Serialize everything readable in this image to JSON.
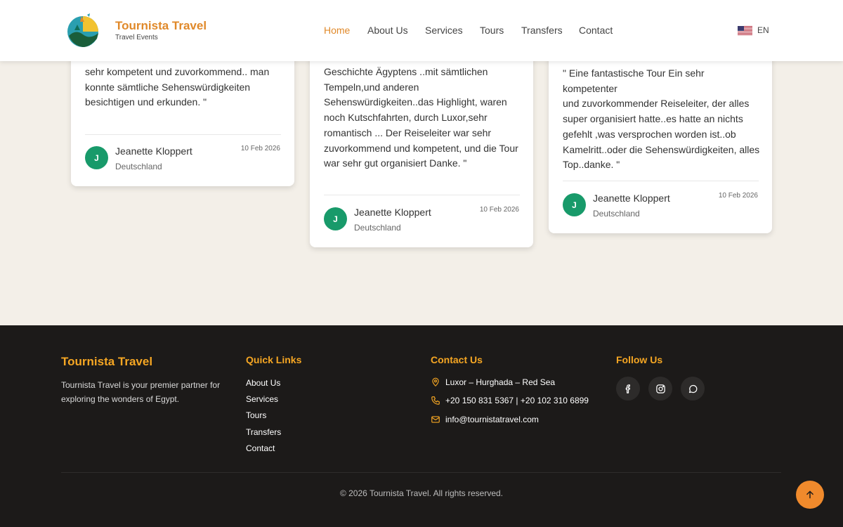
{
  "brand": {
    "name": "Tournista Travel",
    "tagline": "Travel Events",
    "accent_color": "#e0892a"
  },
  "nav": {
    "items": [
      {
        "label": "Home",
        "active": true
      },
      {
        "label": "About Us"
      },
      {
        "label": "Services"
      },
      {
        "label": "Tours"
      },
      {
        "label": "Transfers"
      },
      {
        "label": "Contact"
      }
    ],
    "language": "EN",
    "language_icon": "us-flag-icon"
  },
  "testimonials": [
    {
      "text_visible": [
        "sehr kompetent und zuvorkommend.. man",
        "konnte sämtliche Sehenswürdigkeiten",
        "besichtigen und erkunden. \""
      ],
      "author": "Jeanette Kloppert",
      "avatar_letter": "J",
      "country": "Deutschland",
      "date": "10 Feb 2026"
    },
    {
      "text_visible": [
        "Geschichte Ägyptens ..mit sämtlichen",
        "Tempeln,und anderen",
        "Sehenswürdigkeiten..das Highlight, waren",
        "noch Kutschfahrten, durch Luxor,sehr",
        "romantisch ... Der Reiseleiter war sehr",
        "zuvorkommend und kompetent, und die Tour",
        "war sehr gut organisiert Danke. \""
      ],
      "author": "Jeanette Kloppert",
      "avatar_letter": "J",
      "country": "Deutschland",
      "date": "10 Feb 2026"
    },
    {
      "text_visible": [
        "\" Eine fantastische Tour Ein sehr kompetenter",
        "und zuvorkommender Reiseleiter, der alles",
        "super organisiert hatte..es hatte an nichts",
        "gefehlt ,was versprochen worden ist..ob",
        "Kamelritt..oder die Sehenswürdigkeiten, alles",
        "Top..danke. \""
      ],
      "author": "Jeanette Kloppert",
      "avatar_letter": "J",
      "country": "Deutschland",
      "date": "10 Feb 2026"
    }
  ],
  "footer": {
    "brand": "Tournista Travel",
    "description": "Tournista Travel is your premier partner for exploring the wonders of Egypt.",
    "quick_links_heading": "Quick Links",
    "quick_links": [
      "About Us",
      "Services",
      "Tours",
      "Transfers",
      "Contact"
    ],
    "contact_heading": "Contact Us",
    "contact": {
      "location": "Luxor – Hurghada – Red Sea",
      "phones": "+20 150 831 5367 | +20 102 310 6899",
      "email": "info@tournistatravel.com"
    },
    "follow_heading": "Follow Us",
    "social": [
      "facebook-icon",
      "instagram-icon",
      "whatsapp-icon"
    ],
    "copyright": "© 2026 Tournista Travel. All rights reserved."
  },
  "colors": {
    "footer_bg": "#1c1a19",
    "footer_accent": "#f5a623",
    "avatar_green": "#189a6a",
    "page_bg": "#f3efe8",
    "scroll_top_button": "#f08a2c"
  }
}
